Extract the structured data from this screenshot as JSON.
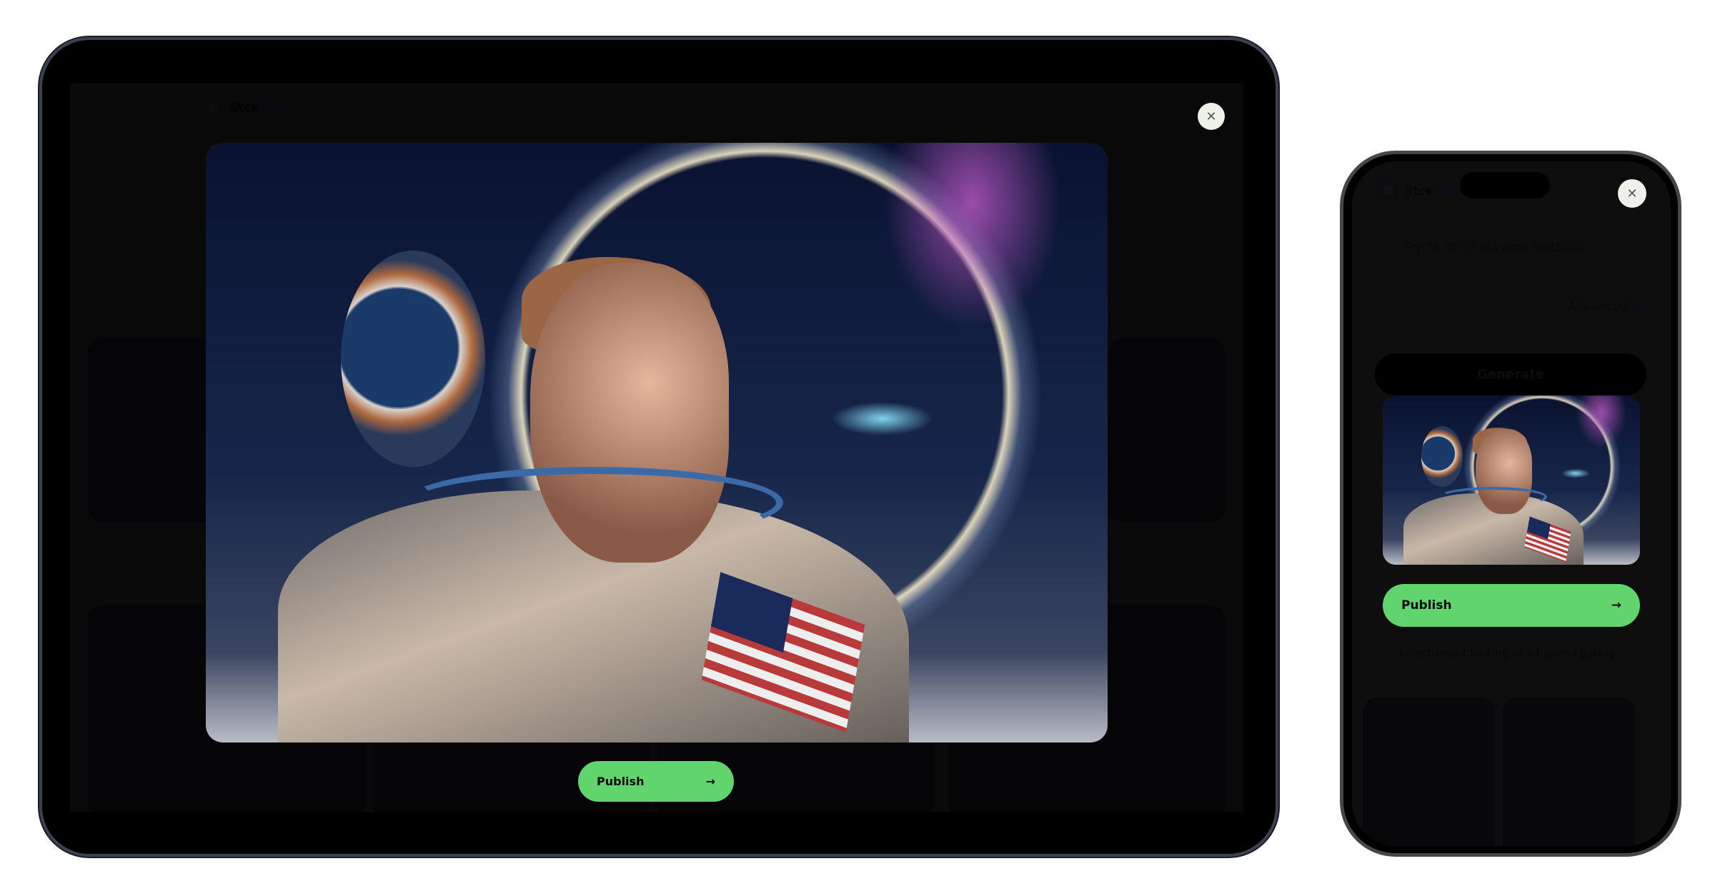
{
  "app": {
    "brand_1": "Stck",
    "brand_2": "Picto"
  },
  "modal": {
    "publish_label": "Publish",
    "arrow": "→",
    "close_icon": "✕"
  },
  "phone": {
    "prompt_placeholder": "Try \"A child playing football\"",
    "advanced_label": "Advanced",
    "generate_label": "Generate",
    "caption": "An astronaut looking at a hopeful galaxy"
  },
  "colors": {
    "accent": "#62d46e",
    "background": "#161616"
  }
}
